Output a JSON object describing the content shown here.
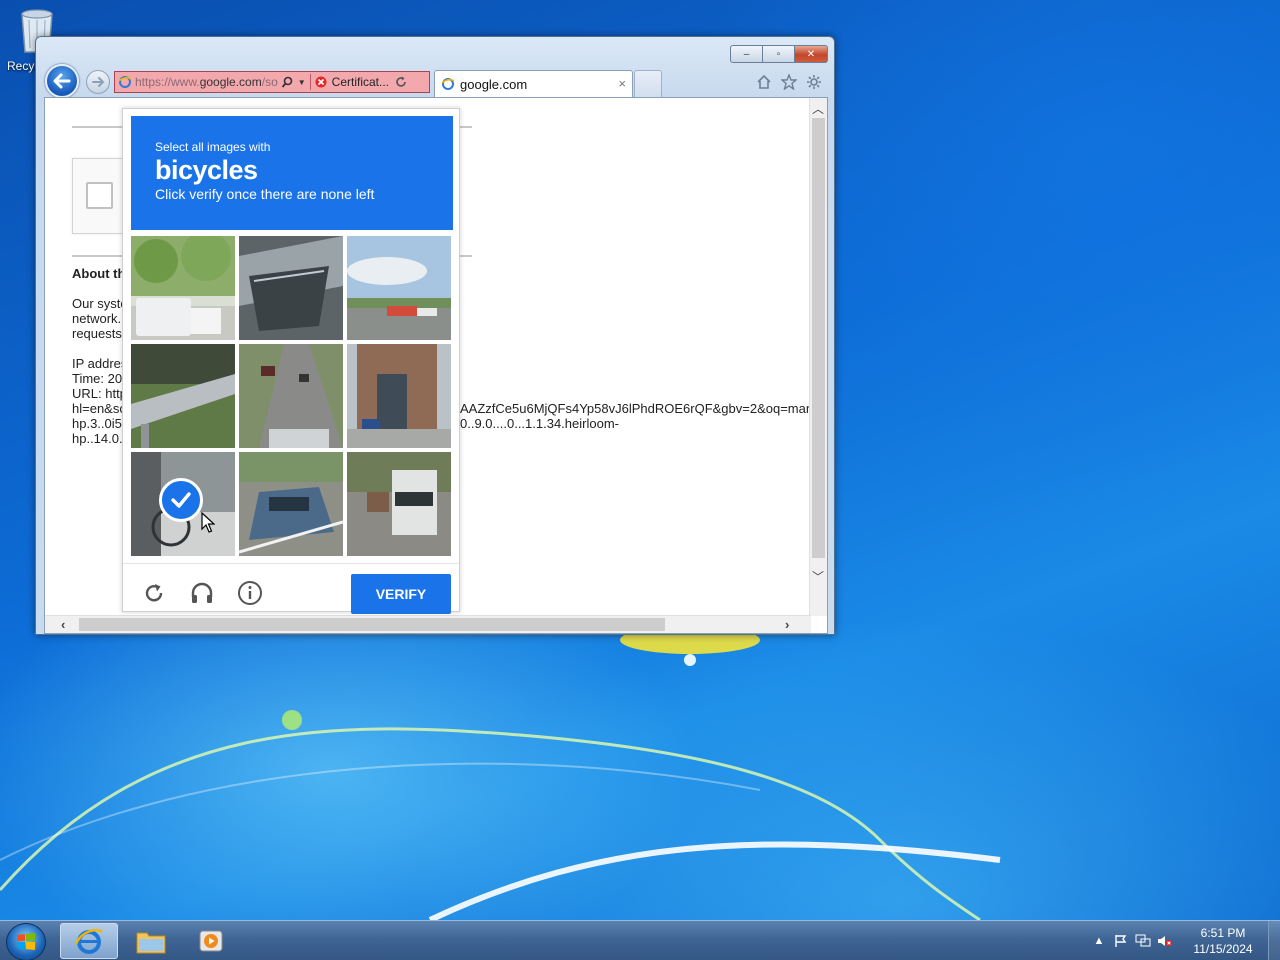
{
  "desktop": {
    "recycle_bin_label": "Recycle Bin"
  },
  "browser": {
    "address": {
      "url_prefix": "https://www.",
      "url_domain": "google.com",
      "url_suffix": "/so",
      "certificate_label": "Certificat..."
    },
    "tab_title": "google.com",
    "tab_close": "×",
    "window_controls": {
      "minimize": "–",
      "maximize": "▫",
      "close": "✕"
    }
  },
  "page": {
    "about_heading": "About th",
    "lines": [
      "Our syste",
      "network.",
      "requests"
    ],
    "info_lines": [
      "IP addres",
      "Time: 20",
      "URL: http",
      "hl=en&sc",
      "hp.3..0i5",
      "hp..14.0."
    ],
    "url_continuation": [
      "AAZzfCe5u6MjQFs4Yp58vJ6lPhdROE6rQF&gbv=2&oq=mar",
      "0..9.0....0...1.1.34.heirloom-"
    ]
  },
  "captcha": {
    "instruction_line1": "Select all images with",
    "target_word": "bicycles",
    "instruction_line3": "Click verify once there are none left",
    "tiles": [
      {
        "id": 1,
        "selected": false
      },
      {
        "id": 2,
        "selected": false
      },
      {
        "id": 3,
        "selected": false
      },
      {
        "id": 4,
        "selected": false
      },
      {
        "id": 5,
        "selected": false
      },
      {
        "id": 6,
        "selected": false
      },
      {
        "id": 7,
        "selected": true
      },
      {
        "id": 8,
        "selected": false
      },
      {
        "id": 9,
        "selected": false
      }
    ],
    "reload_icon": "reload-icon",
    "audio_icon": "headphones-icon",
    "info_icon": "info-icon",
    "verify_label": "VERIFY",
    "accent_color": "#1a73e8"
  },
  "taskbar": {
    "time": "6:51 PM",
    "date": "11/15/2024"
  }
}
